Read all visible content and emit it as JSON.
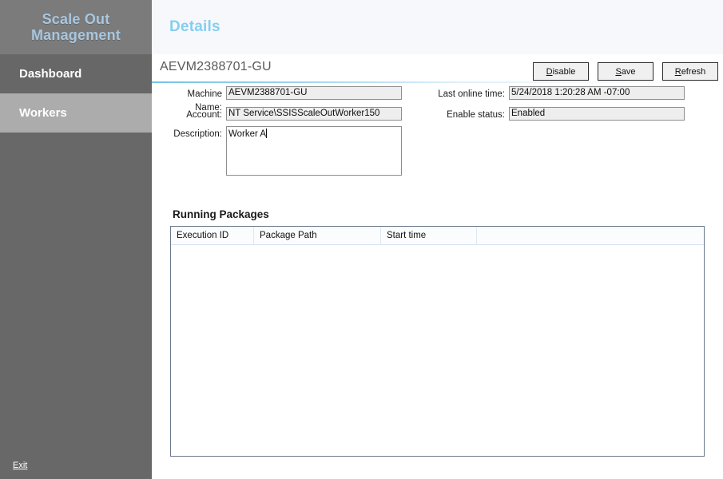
{
  "sidebar": {
    "brand_line1": "Scale Out",
    "brand_line2": "Management",
    "items": [
      {
        "label": "Dashboard",
        "selected": false
      },
      {
        "label": "Workers",
        "selected": true
      }
    ],
    "exit_label": "Exit"
  },
  "header": {
    "title": "Details",
    "entity_title": "AEVM2388701-GU"
  },
  "toolbar": {
    "disable": {
      "accel": "D",
      "rest": "isable"
    },
    "save": {
      "accel": "S",
      "rest": "ave"
    },
    "refresh": {
      "accel": "R",
      "rest": "efresh"
    }
  },
  "form": {
    "machine_name_label": "Machine Name:",
    "machine_name_value": "AEVM2388701-GU",
    "account_label": "Account:",
    "account_value": "NT Service\\SSISScaleOutWorker150",
    "description_label": "Description:",
    "description_value": "Worker A",
    "last_online_label": "Last online time:",
    "last_online_value": "5/24/2018 1:20:28 AM -07:00",
    "enable_status_label": "Enable status:",
    "enable_status_value": "Enabled"
  },
  "running_packages": {
    "section_title": "Running Packages",
    "columns": [
      "Execution ID",
      "Package Path",
      "Start time",
      ""
    ],
    "rows": []
  },
  "colors": {
    "sidebar_bg": "#686868",
    "brand_bg": "#7b7b7b",
    "brand_text": "#a8c6de",
    "nav_selected_bg": "#acacac",
    "header_bg": "#f7f8fc",
    "accent": "#86cef0",
    "grid_border": "#6b7a8d",
    "field_readonly_bg": "#eeeeee"
  }
}
